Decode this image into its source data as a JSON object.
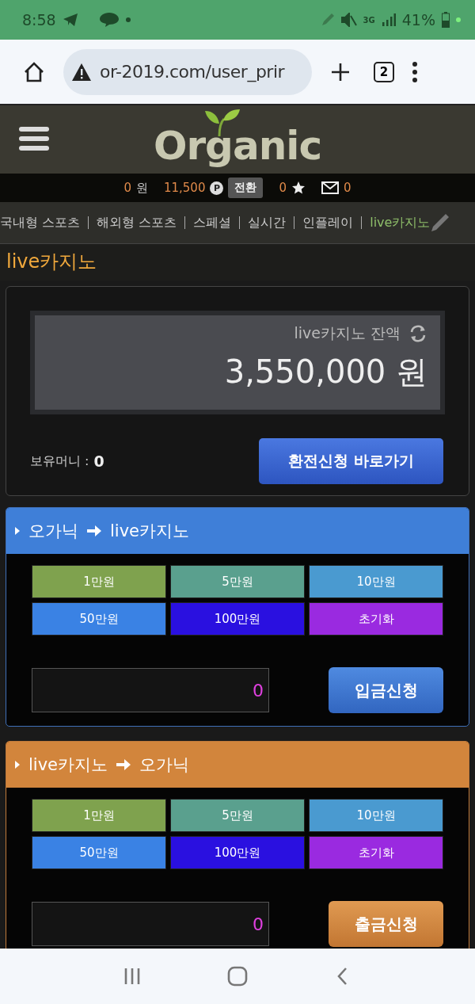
{
  "status_bar": {
    "time": "8:58",
    "network": "3G",
    "battery": "41%"
  },
  "browser": {
    "url": "or-2019.com/user_prir",
    "tab_count": "2"
  },
  "header": {
    "logo": "Organic"
  },
  "info_bar": {
    "money": "0",
    "money_unit": "원",
    "points": "11,500",
    "point_mark": "P",
    "convert_button": "전환",
    "stars": "0",
    "messages": "0"
  },
  "nav": [
    {
      "label": "국내형 스포츠",
      "selected": false
    },
    {
      "label": "해외형 스포츠",
      "selected": false
    },
    {
      "label": "스페셜",
      "selected": false
    },
    {
      "label": "실시간",
      "selected": false
    },
    {
      "label": "인플레이",
      "selected": false
    },
    {
      "label": "live카지노",
      "selected": true
    }
  ],
  "page_title": "live카지노",
  "balance": {
    "label": "live카지노 잔액",
    "amount": "3,550,000 원",
    "held_label": "보유머니 :",
    "held_value": "0",
    "exchange_button": "환전신청 바로가기"
  },
  "sections": [
    {
      "kind": "deposit",
      "from": "오가닉",
      "to": "live카지노",
      "amounts": [
        {
          "label": "1만원",
          "color": "#7fa24e"
        },
        {
          "label": "5만원",
          "color": "#5aa08e"
        },
        {
          "label": "10만원",
          "color": "#4a9ad0"
        },
        {
          "label": "50만원",
          "color": "#3a82e4"
        },
        {
          "label": "100만원",
          "color": "#2a10e0"
        },
        {
          "label": "초기화",
          "color": "#9a2ae0"
        }
      ],
      "value": "0",
      "submit": "입금신청"
    },
    {
      "kind": "withdraw",
      "from": "live카지노",
      "to": "오가닉",
      "amounts": [
        {
          "label": "1만원",
          "color": "#7fa24e"
        },
        {
          "label": "5만원",
          "color": "#5aa08e"
        },
        {
          "label": "10만원",
          "color": "#4a9ad0"
        },
        {
          "label": "50만원",
          "color": "#3a82e4"
        },
        {
          "label": "100만원",
          "color": "#2a10e0"
        },
        {
          "label": "초기화",
          "color": "#9a2ae0"
        }
      ],
      "value": "0",
      "submit": "출금신청"
    }
  ]
}
